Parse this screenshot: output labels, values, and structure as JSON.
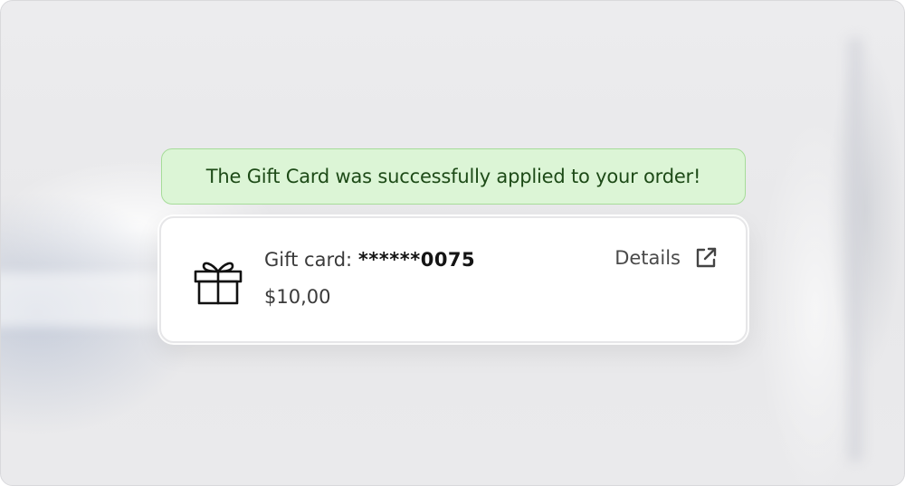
{
  "banner": {
    "message": "The Gift Card was successfully applied to your order!",
    "background": "#dcf5d6",
    "border": "#a6dc99",
    "text_color": "#1d4a17"
  },
  "gift_card": {
    "icon": "gift-icon",
    "label": "Gift card: ",
    "masked_number": "******0075",
    "amount": "$10,00",
    "details_label": "Details",
    "details_icon": "external-link-icon"
  }
}
